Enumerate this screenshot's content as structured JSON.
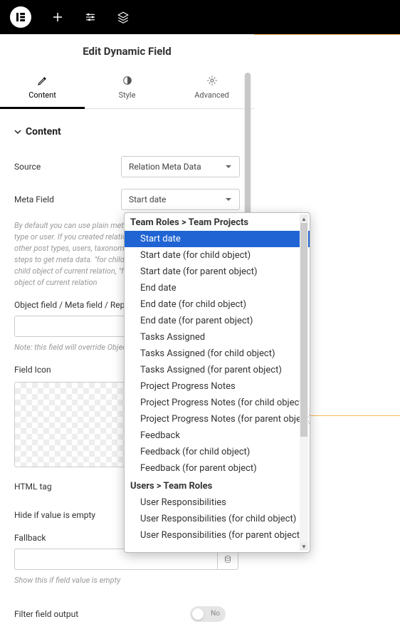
{
  "topbar": {
    "logo": "E"
  },
  "panel": {
    "title": "Edit Dynamic Field",
    "tabs": [
      {
        "label": "Content"
      },
      {
        "label": "Style"
      },
      {
        "label": "Advanced"
      }
    ],
    "section_title": "Content",
    "source": {
      "label": "Source",
      "value": "Relation Meta Data"
    },
    "meta_field": {
      "label": "Meta Field",
      "value": "Start date"
    },
    "help": "By default you can use plain meta fields created for curent post type or user. If you created relation between this post type and other post types, users, taxonomies etc., you need to do additional steps to get meta data. \"for child object\" means meta field from child object of current relation, \"for parent object\" – from parent object of current relation",
    "object_field": {
      "label": "Object field / Meta field / Repeater key / Component prop"
    },
    "object_field_note": "Note: this field will override Object field option",
    "field_icon": {
      "label": "Field Icon"
    },
    "html_tag": {
      "label": "HTML tag"
    },
    "hide_empty": {
      "label": "Hide if value is empty"
    },
    "fallback": {
      "label": "Fallback",
      "note": "Show this if field value is empty"
    },
    "filter_output": {
      "label": "Filter field output",
      "toggle": "No"
    }
  },
  "dropdown": {
    "groups": [
      {
        "title": "Team Roles > Team Projects",
        "items": [
          "Start date",
          "Start date (for child object)",
          "Start date (for parent object)",
          "End date",
          "End date (for child object)",
          "End date (for parent object)",
          "Tasks Assigned",
          "Tasks Assigned (for child object)",
          "Tasks Assigned (for parent object)",
          "Project Progress Notes",
          "Project Progress Notes (for child object)",
          "Project Progress Notes (for parent object)",
          "Feedback",
          "Feedback (for child object)",
          "Feedback (for parent object)"
        ]
      },
      {
        "title": "Users > Team Roles",
        "items": [
          "User Responsibilities",
          "User Responsibilities (for child object)",
          "User Responsibilities (for parent object)"
        ]
      }
    ],
    "selected": "Start date"
  }
}
